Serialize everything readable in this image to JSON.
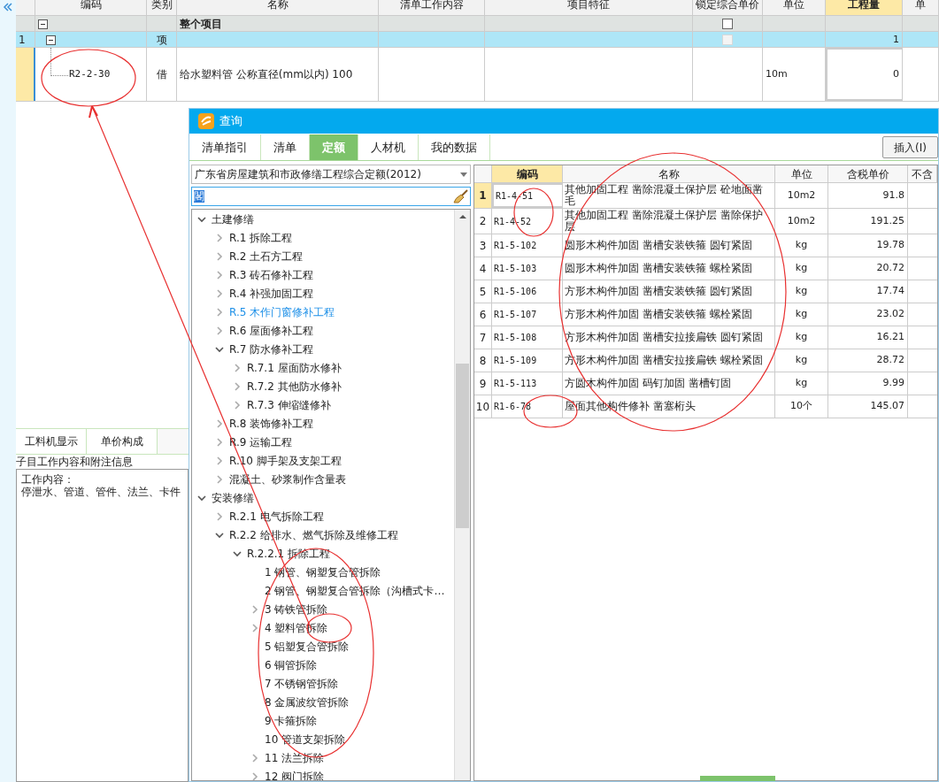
{
  "top_table": {
    "columns": [
      {
        "label": "编码",
        "active": false
      },
      {
        "label": "类别",
        "active": false
      },
      {
        "label": "名称",
        "active": false
      },
      {
        "label": "清单工作内容",
        "active": false
      },
      {
        "label": "项目特征",
        "active": false
      },
      {
        "label": "锁定综合单价",
        "active": false
      },
      {
        "label": "单位",
        "active": false
      },
      {
        "label": "工程量",
        "active": true
      },
      {
        "label": "单",
        "active": false
      }
    ],
    "rows": [
      {
        "kind": "project",
        "name": "整个项目",
        "expanded": true,
        "locked": false,
        "lock_disabled": false
      },
      {
        "kind": "section",
        "number": "1",
        "type": "项",
        "quantity": "1",
        "expanded": true,
        "locked": false,
        "lock_disabled": true
      },
      {
        "kind": "item",
        "code": "R2-2-30",
        "type": "借",
        "name": "给水塑料管 公称直径(mm以内) 100",
        "unit": "10m",
        "quantity": "0"
      }
    ]
  },
  "lower_panel": {
    "tabs": [
      {
        "label": "工料机显示",
        "selected": false
      },
      {
        "label": "单价构成",
        "selected": false
      }
    ],
    "info_title": "子目工作内容和附注信息",
    "info_lines": [
      "工作内容：",
      "停泄水、管道、管件、法兰、卡件"
    ]
  },
  "dialog": {
    "title": "查询",
    "tabs": [
      {
        "label": "清单指引",
        "selected": false
      },
      {
        "label": "清单",
        "selected": false
      },
      {
        "label": "定额",
        "selected": true
      },
      {
        "label": "人材机",
        "selected": false
      },
      {
        "label": "我的数据",
        "selected": false
      }
    ],
    "insert_button": "插入(I)",
    "library": "广东省房屋建筑和市政修缮工程综合定额(2012)",
    "search_value": "閣",
    "tree": [
      {
        "label": "土建修缮",
        "expanded": true,
        "selected": false,
        "children": [
          {
            "label": "R.1 拆除工程",
            "expanded": false,
            "selected": false
          },
          {
            "label": "R.2 土石方工程",
            "expanded": false,
            "selected": false
          },
          {
            "label": "R.3 砖石修补工程",
            "expanded": false,
            "selected": false
          },
          {
            "label": "R.4 补强加固工程",
            "expanded": false,
            "selected": false
          },
          {
            "label": "R.5 木作门窗修补工程",
            "expanded": false,
            "selected": true
          },
          {
            "label": "R.6 屋面修补工程",
            "expanded": false,
            "selected": false
          },
          {
            "label": "R.7 防水修补工程",
            "expanded": true,
            "selected": false,
            "children": [
              {
                "label": "R.7.1 屋面防水修补",
                "expanded": false,
                "selected": false
              },
              {
                "label": "R.7.2 其他防水修补",
                "expanded": false,
                "selected": false
              },
              {
                "label": "R.7.3 伸缩缝修补",
                "expanded": false,
                "selected": false
              }
            ]
          },
          {
            "label": "R.8 装饰修补工程",
            "expanded": false,
            "selected": false
          },
          {
            "label": "R.9 运输工程",
            "expanded": false,
            "selected": false
          },
          {
            "label": "R.10 脚手架及支架工程",
            "expanded": false,
            "selected": false
          },
          {
            "label": "混凝土、砂浆制作含量表",
            "expanded": false,
            "selected": false
          }
        ]
      },
      {
        "label": "安装修缮",
        "expanded": true,
        "selected": false,
        "children": [
          {
            "label": "R.2.1 电气拆除工程",
            "expanded": false,
            "selected": false
          },
          {
            "label": "R.2.2 给排水、燃气拆除及维修工程",
            "expanded": true,
            "selected": false,
            "children": [
              {
                "label": "R.2.2.1 拆除工程",
                "expanded": true,
                "selected": false,
                "children": [
                  {
                    "label": "1 钢管、钢塑复合管拆除",
                    "selected": false
                  },
                  {
                    "label": "2 钢管、钢塑复合管拆除（沟槽式卡…",
                    "selected": false
                  },
                  {
                    "label": "3 铸铁管拆除",
                    "expanded": false,
                    "selected": false
                  },
                  {
                    "label": "4 塑料管拆除",
                    "expanded": false,
                    "selected": false
                  },
                  {
                    "label": "5 铝塑复合管拆除",
                    "selected": false
                  },
                  {
                    "label": "6 铜管拆除",
                    "selected": false
                  },
                  {
                    "label": "7 不锈钢管拆除",
                    "selected": false
                  },
                  {
                    "label": "8 金属波纹管拆除",
                    "selected": false
                  },
                  {
                    "label": "9 卡箍拆除",
                    "selected": false
                  },
                  {
                    "label": "10 管道支架拆除",
                    "selected": false
                  },
                  {
                    "label": "11 法兰拆除",
                    "expanded": false,
                    "selected": false
                  },
                  {
                    "label": "12 阀门拆除",
                    "expanded": false,
                    "selected": false
                  }
                ]
              }
            ]
          }
        ]
      }
    ],
    "results": {
      "columns": [
        {
          "label": "编码",
          "active": true
        },
        {
          "label": "名称",
          "active": false
        },
        {
          "label": "单位",
          "active": false
        },
        {
          "label": "含税单价",
          "active": false
        },
        {
          "label": "不含",
          "active": false
        }
      ],
      "rows": [
        {
          "number": "1",
          "code": "R1-4-51",
          "name": "其他加固工程 凿除混凝土保护层 砼地面凿毛",
          "unit": "10m2",
          "price": "91.8",
          "selected": true
        },
        {
          "number": "2",
          "code": "R1-4-52",
          "name": "其他加固工程 凿除混凝土保护层 凿除保护层",
          "unit": "10m2",
          "price": "191.25",
          "selected": false
        },
        {
          "number": "3",
          "code": "R1-5-102",
          "name": "圆形木构件加固 凿槽安装铁箍 圆钉紧固",
          "unit": "kg",
          "price": "19.78",
          "selected": false
        },
        {
          "number": "4",
          "code": "R1-5-103",
          "name": "圆形木构件加固 凿槽安装铁箍 螺栓紧固",
          "unit": "kg",
          "price": "20.72",
          "selected": false
        },
        {
          "number": "5",
          "code": "R1-5-106",
          "name": "方形木构件加固 凿槽安装铁箍 圆钉紧固",
          "unit": "kg",
          "price": "17.74",
          "selected": false
        },
        {
          "number": "6",
          "code": "R1-5-107",
          "name": "方形木构件加固 凿槽安装铁箍 螺栓紧固",
          "unit": "kg",
          "price": "23.02",
          "selected": false
        },
        {
          "number": "7",
          "code": "R1-5-108",
          "name": "方形木构件加固 凿槽安拉接扁铁 圆钉紧固",
          "unit": "kg",
          "price": "16.21",
          "selected": false
        },
        {
          "number": "8",
          "code": "R1-5-109",
          "name": "方形木构件加固 凿槽安拉接扁铁 螺栓紧固",
          "unit": "kg",
          "price": "28.72",
          "selected": false
        },
        {
          "number": "9",
          "code": "R1-5-113",
          "name": "方圆木构件加固 码钉加固 凿槽钉固",
          "unit": "kg",
          "price": "9.99",
          "selected": false
        },
        {
          "number": "10",
          "code": "R1-6-78",
          "name": "屋面其他构件修补 凿塞桁头",
          "unit": "10个",
          "price": "145.07",
          "selected": false
        }
      ]
    }
  }
}
